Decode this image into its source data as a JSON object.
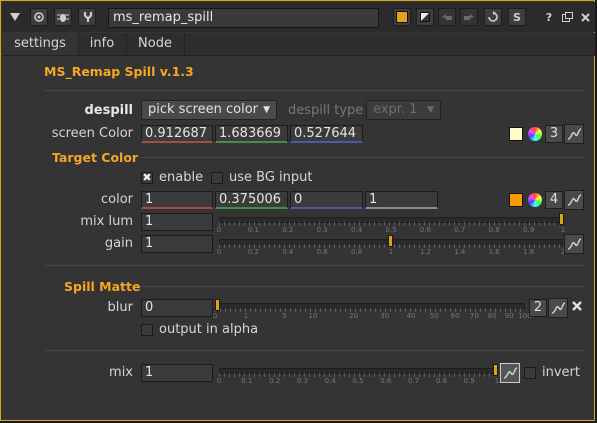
{
  "titlebar": {
    "node_name": "ms_remap_spill",
    "buttons": [
      "collapse-icon",
      "center-icon",
      "bug-icon",
      "wrench-icon",
      "color-icon",
      "transparency-icon",
      "undo-icon",
      "redo-icon",
      "revert-icon",
      "s-icon",
      "help-icon",
      "float-icon",
      "close-icon"
    ],
    "s_label": "S",
    "help_label": "?"
  },
  "tabs": [
    {
      "label": "settings",
      "active": true
    },
    {
      "label": "info",
      "active": false
    },
    {
      "label": "Node",
      "active": false
    }
  ],
  "header": {
    "title": "MS_Remap Spill v.1.3"
  },
  "despill": {
    "label": "despill",
    "method": "pick screen color",
    "type_label": "despill type",
    "type_value": "expr. 1"
  },
  "screen_color": {
    "label": "screen Color",
    "r": "0.912687",
    "g": "1.683669",
    "b": "0.527644",
    "channels": "3",
    "swatch": "#fffacc"
  },
  "target_color": {
    "section": "Target Color",
    "enable_label": "enable",
    "enable_checked": true,
    "use_bg_label": "use BG input",
    "use_bg_checked": false,
    "color_label": "color",
    "r": "1",
    "g": "0.375006",
    "b": "0",
    "a": "1",
    "channels": "4",
    "swatch": "#f59a00",
    "mix_lum_label": "mix lum",
    "mix_lum_value": "1",
    "mix_lum_ticks": [
      "0",
      "0.1",
      "0.2",
      "0.3",
      "0.4",
      "0.5",
      "0.6",
      "0.7",
      "0.8",
      "0.9",
      "1"
    ],
    "gain_label": "gain",
    "gain_value": "1",
    "gain_ticks": [
      "0",
      "0.2",
      "0.4",
      "0.6",
      "0.8",
      "1",
      "1.2",
      "1.4",
      "1.6",
      "1.8",
      "2"
    ]
  },
  "spill_matte": {
    "section": "Spill Matte",
    "blur_label": "blur",
    "blur_value": "0",
    "blur_ticks": [
      "0",
      "1",
      "5",
      "10",
      "20",
      "30",
      "40",
      "50",
      "60",
      "70",
      "80",
      "90",
      "100"
    ],
    "channels": "2",
    "output_alpha_label": "output in alpha",
    "output_alpha_checked": false
  },
  "mix": {
    "label": "mix",
    "value": "1",
    "ticks": [
      "0",
      "0.1",
      "0.2",
      "0.3",
      "0.4",
      "0.5",
      "0.6",
      "0.7",
      "0.8",
      "0.9",
      "1"
    ],
    "invert_label": "invert",
    "invert_checked": false
  },
  "colors": {
    "accent": "#e0a21c",
    "section": "#f5a623",
    "panel": "#343434"
  }
}
